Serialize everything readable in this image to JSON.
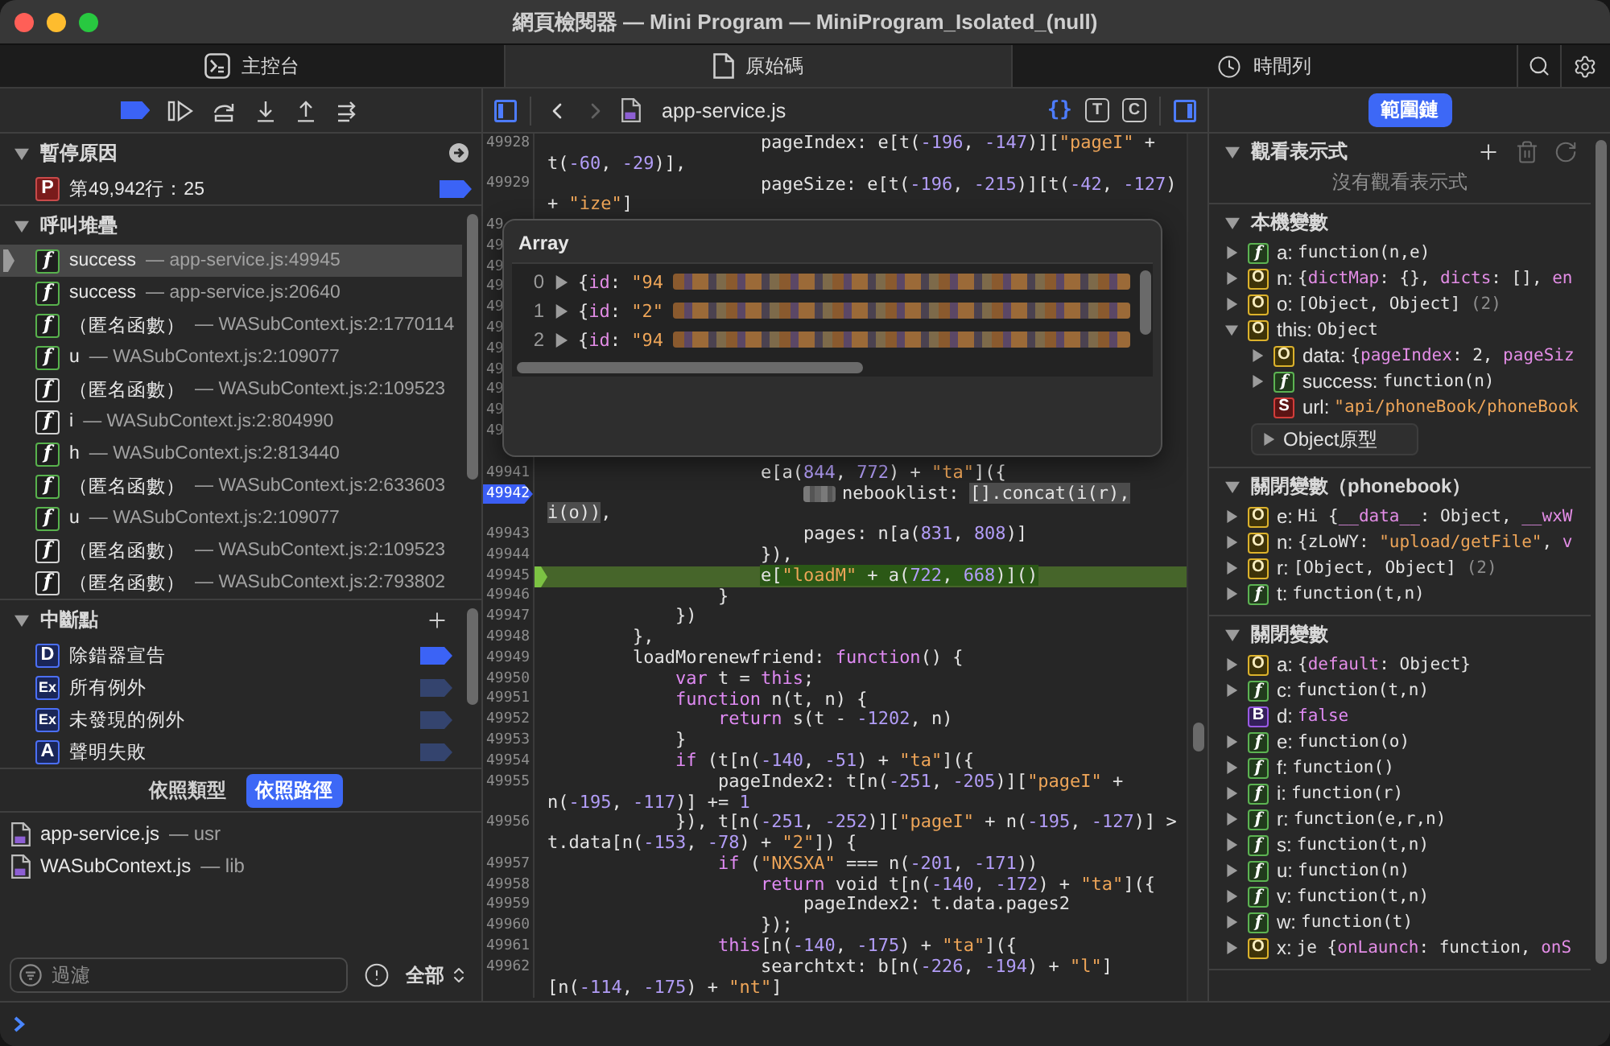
{
  "window": {
    "title": "網頁檢閱器 — Mini Program — MiniProgram_Isolated_(null)"
  },
  "tabs": [
    {
      "label": "主控台",
      "selected": false
    },
    {
      "label": "原始碼",
      "selected": true
    },
    {
      "label": "時間列",
      "selected": false
    }
  ],
  "debugger": {
    "breakpoints_active": true,
    "pause_reason": {
      "title": "暫停原因",
      "expanded": true,
      "badge": "P",
      "text": "第49,942行：25",
      "breakpoint_enabled": true
    },
    "call_stack": {
      "title": "呼叫堆疊",
      "expanded": true,
      "frames": [
        {
          "badge": "f",
          "color": "#58b24d",
          "name": "success",
          "location": "— app-service.js:49945",
          "selected": true
        },
        {
          "badge": "f",
          "color": "#58b24d",
          "name": "success",
          "location": "— app-service.js:20640",
          "selected": false
        },
        {
          "badge": "f",
          "color": "#58b24d",
          "name": "（匿名函數）",
          "location": "— WASubContext.js:2:1770114",
          "selected": false
        },
        {
          "badge": "f",
          "color": "#58b24d",
          "name": "u",
          "location": "— WASubContext.js:2:109077",
          "selected": false
        },
        {
          "badge": "f",
          "color": "#d2d2d2",
          "name": "（匿名函數）",
          "location": "— WASubContext.js:2:109523",
          "selected": false
        },
        {
          "badge": "f",
          "color": "#d2d2d2",
          "name": "i",
          "location": "— WASubContext.js:2:804990",
          "selected": false
        },
        {
          "badge": "f",
          "color": "#58b24d",
          "name": "h",
          "location": "— WASubContext.js:2:813440",
          "selected": false
        },
        {
          "badge": "f",
          "color": "#58b24d",
          "name": "（匿名函數）",
          "location": "— WASubContext.js:2:633603",
          "selected": false
        },
        {
          "badge": "f",
          "color": "#58b24d",
          "name": "u",
          "location": "— WASubContext.js:2:109077",
          "selected": false
        },
        {
          "badge": "f",
          "color": "#d2d2d2",
          "name": "（匿名函數）",
          "location": "— WASubContext.js:2:109523",
          "selected": false
        },
        {
          "badge": "f",
          "color": "#d2d2d2",
          "name": "（匿名函數）",
          "location": "— WASubContext.js:2:793802",
          "selected": false
        }
      ]
    },
    "breakpoints": {
      "title": "中斷點",
      "expanded": true,
      "items": [
        {
          "badge": "D",
          "label": "除錯器宣告",
          "enabled": true
        },
        {
          "badge": "Ex",
          "label": "所有例外",
          "enabled": false
        },
        {
          "badge": "Ex",
          "label": "未發現的例外",
          "enabled": false
        },
        {
          "badge": "A",
          "label": "聲明失敗",
          "enabled": false
        }
      ]
    },
    "grouping": [
      {
        "label": "依照類型",
        "selected": false
      },
      {
        "label": "依照路徑",
        "selected": true
      }
    ],
    "files": [
      {
        "name": "app-service.js",
        "origin": "— usr"
      },
      {
        "name": "WASubContext.js",
        "origin": "— lib"
      }
    ],
    "filter": {
      "placeholder": "過濾",
      "scope": "全部"
    }
  },
  "editor": {
    "file": "app-service.js",
    "back_enabled": true,
    "forward_enabled": false,
    "navigator_shown": true,
    "details_shown": true,
    "toggles": [
      {
        "kind": "brace",
        "label": "{}",
        "on": true
      },
      {
        "kind": "boxed",
        "label": "T",
        "on": false
      },
      {
        "kind": "boxed",
        "label": "C",
        "on": false
      }
    ],
    "lines": [
      {
        "number": "49928",
        "breakpoint": false,
        "current": false,
        "tokens": [
          {
            "kind": "plain",
            "text": "                    pageIndex: e[t("
          },
          {
            "kind": "number",
            "text": "-196"
          },
          {
            "kind": "plain",
            "text": ", "
          },
          {
            "kind": "number",
            "text": "-147"
          },
          {
            "kind": "plain",
            "text": ")]["
          },
          {
            "kind": "string",
            "text": "\"pageI\""
          },
          {
            "kind": "plain",
            "text": " +"
          }
        ],
        "wrap": [
          {
            "kind": "plain",
            "text": "t("
          },
          {
            "kind": "number",
            "text": "-60"
          },
          {
            "kind": "plain",
            "text": ", "
          },
          {
            "kind": "number",
            "text": "-29"
          },
          {
            "kind": "plain",
            "text": ")],"
          }
        ]
      },
      {
        "number": "49929",
        "breakpoint": false,
        "current": false,
        "tokens": [
          {
            "kind": "plain",
            "text": "                    pageSize: e[t("
          },
          {
            "kind": "number",
            "text": "-196"
          },
          {
            "kind": "plain",
            "text": ", "
          },
          {
            "kind": "number",
            "text": "-215"
          },
          {
            "kind": "plain",
            "text": ")][t("
          },
          {
            "kind": "number",
            "text": "-42"
          },
          {
            "kind": "plain",
            "text": ", "
          },
          {
            "kind": "number",
            "text": "-127"
          },
          {
            "kind": "plain",
            "text": ")"
          }
        ],
        "wrap": [
          {
            "kind": "plain",
            "text": "+ "
          },
          {
            "kind": "string",
            "text": "\"ize\""
          },
          {
            "kind": "plain",
            "text": "]"
          }
        ]
      },
      {
        "number": "49",
        "breakpoint": false
      },
      {
        "number": "49",
        "breakpoint": false
      },
      {
        "number": "49",
        "breakpoint": false
      },
      {
        "number": "49",
        "breakpoint": false
      },
      {
        "number": "49",
        "breakpoint": false
      },
      {
        "number": "49",
        "breakpoint": false
      },
      {
        "number": "49",
        "breakpoint": false
      },
      {
        "number": "49",
        "breakpoint": false
      },
      {
        "number": "49",
        "breakpoint": false
      },
      {
        "number": "49",
        "breakpoint": false
      },
      {
        "number": "49",
        "breakpoint": false
      },
      {
        "number": "49941",
        "breakpoint": false,
        "current": false,
        "tokens": [
          {
            "kind": "plain",
            "text": "                    e[a("
          },
          {
            "kind": "number",
            "text": "844"
          },
          {
            "kind": "plain",
            "text": ", "
          },
          {
            "kind": "number",
            "text": "772"
          },
          {
            "kind": "plain",
            "text": ") + "
          },
          {
            "kind": "string",
            "text": "\"ta\""
          },
          {
            "kind": "plain",
            "text": "]({"
          }
        ]
      },
      {
        "number": "49942",
        "breakpoint": true,
        "current": false,
        "tokens": [
          {
            "kind": "plain",
            "text": "                        nebooklist: ",
            "redacted_prefix": true
          },
          {
            "kind": "plain",
            "text": "[].concat(i(r),",
            "highlighted": true
          }
        ],
        "wrap": [
          {
            "kind": "plain",
            "text": "i(o))",
            "highlighted": true
          },
          {
            "kind": "plain",
            "text": ","
          }
        ]
      },
      {
        "number": "49943",
        "breakpoint": false,
        "current": false,
        "tokens": [
          {
            "kind": "plain",
            "text": "                        pages: n[a("
          },
          {
            "kind": "number",
            "text": "831"
          },
          {
            "kind": "plain",
            "text": ", "
          },
          {
            "kind": "number",
            "text": "808"
          },
          {
            "kind": "plain",
            "text": ")]"
          }
        ]
      },
      {
        "number": "49944",
        "breakpoint": false,
        "current": false,
        "tokens": [
          {
            "kind": "plain",
            "text": "                    }),"
          }
        ]
      },
      {
        "number": "49945",
        "breakpoint": false,
        "current": true,
        "tokens": [
          {
            "kind": "plain",
            "text": "                    e[",
            "highlighted": true
          },
          {
            "kind": "string",
            "text": "\"loadM\"",
            "highlighted": true
          },
          {
            "kind": "plain",
            "text": " + a(",
            "highlighted": true
          },
          {
            "kind": "number",
            "text": "722",
            "highlighted": true
          },
          {
            "kind": "plain",
            "text": ", ",
            "highlighted": true
          },
          {
            "kind": "number",
            "text": "668",
            "highlighted": true
          },
          {
            "kind": "plain",
            "text": ")]()",
            "highlighted": true
          }
        ]
      },
      {
        "number": "49946",
        "breakpoint": false,
        "current": false,
        "tokens": [
          {
            "kind": "plain",
            "text": "                }"
          }
        ]
      },
      {
        "number": "49947",
        "breakpoint": false,
        "current": false,
        "tokens": [
          {
            "kind": "plain",
            "text": "            })"
          }
        ]
      },
      {
        "number": "49948",
        "breakpoint": false,
        "current": false,
        "tokens": [
          {
            "kind": "plain",
            "text": "        },"
          }
        ]
      },
      {
        "number": "49949",
        "breakpoint": false,
        "current": false,
        "tokens": [
          {
            "kind": "plain",
            "text": "        loadMorenewfriend: "
          },
          {
            "kind": "keyword",
            "text": "function"
          },
          {
            "kind": "plain",
            "text": "() {"
          }
        ]
      },
      {
        "number": "49950",
        "breakpoint": false,
        "current": false,
        "tokens": [
          {
            "kind": "keyword",
            "text": "            var"
          },
          {
            "kind": "plain",
            "text": " t = "
          },
          {
            "kind": "keyword",
            "text": "this"
          },
          {
            "kind": "plain",
            "text": ";"
          }
        ]
      },
      {
        "number": "49951",
        "breakpoint": false,
        "current": false,
        "tokens": [
          {
            "kind": "keyword",
            "text": "            function"
          },
          {
            "kind": "plain",
            "text": " n(t, n) {"
          }
        ]
      },
      {
        "number": "49952",
        "breakpoint": false,
        "current": false,
        "tokens": [
          {
            "kind": "keyword",
            "text": "                return"
          },
          {
            "kind": "plain",
            "text": " s(t - "
          },
          {
            "kind": "number",
            "text": "-1202"
          },
          {
            "kind": "plain",
            "text": ", n)"
          }
        ]
      },
      {
        "number": "49953",
        "breakpoint": false,
        "current": false,
        "tokens": [
          {
            "kind": "plain",
            "text": "            }"
          }
        ]
      },
      {
        "number": "49954",
        "breakpoint": false,
        "current": false,
        "tokens": [
          {
            "kind": "keyword",
            "text": "            if"
          },
          {
            "kind": "plain",
            "text": " (t[n("
          },
          {
            "kind": "number",
            "text": "-140"
          },
          {
            "kind": "plain",
            "text": ", "
          },
          {
            "kind": "number",
            "text": "-51"
          },
          {
            "kind": "plain",
            "text": ") + "
          },
          {
            "kind": "string",
            "text": "\"ta\""
          },
          {
            "kind": "plain",
            "text": "]({"
          }
        ]
      },
      {
        "number": "49955",
        "breakpoint": false,
        "current": false,
        "tokens": [
          {
            "kind": "plain",
            "text": "                pageIndex2: t[n("
          },
          {
            "kind": "number",
            "text": "-251"
          },
          {
            "kind": "plain",
            "text": ", "
          },
          {
            "kind": "number",
            "text": "-205"
          },
          {
            "kind": "plain",
            "text": ")]["
          },
          {
            "kind": "string",
            "text": "\"pageI\""
          },
          {
            "kind": "plain",
            "text": " +"
          }
        ],
        "wrap": [
          {
            "kind": "plain",
            "text": "n("
          },
          {
            "kind": "number",
            "text": "-195"
          },
          {
            "kind": "plain",
            "text": ", "
          },
          {
            "kind": "number",
            "text": "-117"
          },
          {
            "kind": "plain",
            "text": ")] += "
          },
          {
            "kind": "number",
            "text": "1"
          }
        ]
      },
      {
        "number": "49956",
        "breakpoint": false,
        "current": false,
        "tokens": [
          {
            "kind": "plain",
            "text": "            }), t[n("
          },
          {
            "kind": "number",
            "text": "-251"
          },
          {
            "kind": "plain",
            "text": ", "
          },
          {
            "kind": "number",
            "text": "-252"
          },
          {
            "kind": "plain",
            "text": ")]["
          },
          {
            "kind": "string",
            "text": "\"pageI\""
          },
          {
            "kind": "plain",
            "text": " + n("
          },
          {
            "kind": "number",
            "text": "-195"
          },
          {
            "kind": "plain",
            "text": ", "
          },
          {
            "kind": "number",
            "text": "-127"
          },
          {
            "kind": "plain",
            "text": ")] >"
          }
        ],
        "wrap": [
          {
            "kind": "plain",
            "text": "t.data[n("
          },
          {
            "kind": "number",
            "text": "-153"
          },
          {
            "kind": "plain",
            "text": ", "
          },
          {
            "kind": "number",
            "text": "-78"
          },
          {
            "kind": "plain",
            "text": ") + "
          },
          {
            "kind": "string",
            "text": "\"2\""
          },
          {
            "kind": "plain",
            "text": "]) {"
          }
        ]
      },
      {
        "number": "49957",
        "breakpoint": false,
        "current": false,
        "tokens": [
          {
            "kind": "keyword",
            "text": "                if"
          },
          {
            "kind": "plain",
            "text": " ("
          },
          {
            "kind": "string",
            "text": "\"NXSXA\""
          },
          {
            "kind": "plain",
            "text": " === n("
          },
          {
            "kind": "number",
            "text": "-201"
          },
          {
            "kind": "plain",
            "text": ", "
          },
          {
            "kind": "number",
            "text": "-171"
          },
          {
            "kind": "plain",
            "text": "))"
          }
        ]
      },
      {
        "number": "49958",
        "breakpoint": false,
        "current": false,
        "tokens": [
          {
            "kind": "keyword",
            "text": "                    return"
          },
          {
            "kind": "plain",
            "text": " void t[n("
          },
          {
            "kind": "number",
            "text": "-140"
          },
          {
            "kind": "plain",
            "text": ", "
          },
          {
            "kind": "number",
            "text": "-172"
          },
          {
            "kind": "plain",
            "text": ") + "
          },
          {
            "kind": "string",
            "text": "\"ta\""
          },
          {
            "kind": "plain",
            "text": "]({"
          }
        ]
      },
      {
        "number": "49959",
        "breakpoint": false,
        "current": false,
        "tokens": [
          {
            "kind": "plain",
            "text": "                        pageIndex2: t.data.pages2"
          }
        ]
      },
      {
        "number": "49960",
        "breakpoint": false,
        "current": false,
        "tokens": [
          {
            "kind": "plain",
            "text": "                    });"
          }
        ]
      },
      {
        "number": "49961",
        "breakpoint": false,
        "current": false,
        "tokens": [
          {
            "kind": "keyword",
            "text": "                this"
          },
          {
            "kind": "plain",
            "text": "[n("
          },
          {
            "kind": "number",
            "text": "-140"
          },
          {
            "kind": "plain",
            "text": ", "
          },
          {
            "kind": "number",
            "text": "-175"
          },
          {
            "kind": "plain",
            "text": ") + "
          },
          {
            "kind": "string",
            "text": "\"ta\""
          },
          {
            "kind": "plain",
            "text": "]({"
          }
        ]
      },
      {
        "number": "49962",
        "breakpoint": false,
        "current": false,
        "tokens": [
          {
            "kind": "plain",
            "text": "                    searchtxt: b[n("
          },
          {
            "kind": "number",
            "text": "-226"
          },
          {
            "kind": "plain",
            "text": ", "
          },
          {
            "kind": "number",
            "text": "-194"
          },
          {
            "kind": "plain",
            "text": ") + "
          },
          {
            "kind": "string",
            "text": "\"l\""
          },
          {
            "kind": "plain",
            "text": "]"
          }
        ],
        "wrap": [
          {
            "kind": "plain",
            "text": "[n("
          },
          {
            "kind": "number",
            "text": "-114"
          },
          {
            "kind": "plain",
            "text": ", "
          },
          {
            "kind": "number",
            "text": "-175"
          },
          {
            "kind": "plain",
            "text": ") + "
          },
          {
            "kind": "string",
            "text": "\"nt\""
          },
          {
            "kind": "plain",
            "text": "]"
          }
        ]
      }
    ],
    "popover": {
      "title": "Array",
      "items": [
        {
          "index": "0",
          "expanded": false,
          "preview": [
            {
              "kind": "plain",
              "text": "{"
            },
            {
              "kind": "key",
              "text": "id"
            },
            {
              "kind": "plain",
              "text": ": "
            },
            {
              "kind": "string",
              "text": "\"94"
            }
          ]
        },
        {
          "index": "1",
          "expanded": false,
          "preview": [
            {
              "kind": "plain",
              "text": "{"
            },
            {
              "kind": "key",
              "text": "id"
            },
            {
              "kind": "plain",
              "text": ": "
            },
            {
              "kind": "string",
              "text": "\"2\""
            }
          ]
        },
        {
          "index": "2",
          "expanded": false,
          "preview": [
            {
              "kind": "plain",
              "text": "{"
            },
            {
              "kind": "key",
              "text": "id"
            },
            {
              "kind": "plain",
              "text": ": "
            },
            {
              "kind": "string",
              "text": "\"94"
            }
          ]
        }
      ]
    }
  },
  "details": {
    "tabs": [
      {
        "label": "範圍鏈",
        "selected": true
      }
    ],
    "sections": [
      {
        "kind": "watch",
        "title": "觀看表示式",
        "expanded": true,
        "actions": [
          {
            "disabled": false
          },
          {
            "disabled": true
          },
          {
            "disabled": true
          }
        ],
        "empty_message": "沒有觀看表示式"
      },
      {
        "kind": "variables",
        "title": "本機變數",
        "expanded": true,
        "variables": [
          {
            "kind": "function",
            "badge": "f",
            "name": "a:",
            "expanded": false,
            "value": [
              {
                "kind": "plain",
                "text": "function(n,e)"
              }
            ]
          },
          {
            "kind": "object",
            "badge": "O",
            "name": "n:",
            "expanded": false,
            "value": [
              {
                "kind": "plain",
                "text": "{"
              },
              {
                "kind": "key",
                "text": "dictMap"
              },
              {
                "kind": "plain",
                "text": ": {}, "
              },
              {
                "kind": "key",
                "text": "dicts"
              },
              {
                "kind": "plain",
                "text": ": [], "
              },
              {
                "kind": "key",
                "text": "en"
              }
            ]
          },
          {
            "kind": "object",
            "badge": "O",
            "name": "o:",
            "expanded": false,
            "value": [
              {
                "kind": "plain",
                "text": "[Object, Object] "
              },
              {
                "kind": "muted",
                "text": "(2)"
              }
            ]
          },
          {
            "kind": "object",
            "badge": "O",
            "name": "this:",
            "expanded": true,
            "value": [
              {
                "kind": "plain",
                "text": "Object"
              }
            ],
            "children": [
              {
                "kind": "object",
                "badge": "O",
                "name": "data:",
                "expanded": false,
                "value": [
                  {
                    "kind": "plain",
                    "text": "{"
                  },
                  {
                    "kind": "key",
                    "text": "pageIndex"
                  },
                  {
                    "kind": "plain",
                    "text": ": 2, "
                  },
                  {
                    "kind": "key",
                    "text": "pageSiz"
                  }
                ]
              },
              {
                "kind": "function",
                "badge": "f",
                "name": "success:",
                "expanded": false,
                "value": [
                  {
                    "kind": "plain",
                    "text": "function(n)"
                  }
                ]
              },
              {
                "kind": "string",
                "badge": "S",
                "name": "url:",
                "value": [
                  {
                    "kind": "string",
                    "text": "\"api/phoneBook/phoneBook"
                  }
                ]
              }
            ],
            "prototype": {
              "label": "Object原型",
              "expanded": false
            }
          }
        ]
      },
      {
        "kind": "variables",
        "title": "關閉變數（phonebook）",
        "expanded": true,
        "variables": [
          {
            "kind": "object",
            "badge": "O",
            "name": "e:",
            "expanded": false,
            "value": [
              {
                "kind": "plain",
                "text": "Hi {"
              },
              {
                "kind": "key",
                "text": "__data__"
              },
              {
                "kind": "plain",
                "text": ": Object, "
              },
              {
                "kind": "key",
                "text": "__wxW"
              }
            ]
          },
          {
            "kind": "object",
            "badge": "O",
            "name": "n:",
            "expanded": false,
            "value": [
              {
                "kind": "plain",
                "text": "{zLoWY: "
              },
              {
                "kind": "string",
                "text": "\"upload/getFile\""
              },
              {
                "kind": "plain",
                "text": ", "
              },
              {
                "kind": "key",
                "text": "v"
              }
            ]
          },
          {
            "kind": "object",
            "badge": "O",
            "name": "r:",
            "expanded": false,
            "value": [
              {
                "kind": "plain",
                "text": "[Object, Object] "
              },
              {
                "kind": "muted",
                "text": "(2)"
              }
            ]
          },
          {
            "kind": "function",
            "badge": "f",
            "name": "t:",
            "expanded": false,
            "value": [
              {
                "kind": "plain",
                "text": "function(t,n)"
              }
            ]
          }
        ]
      },
      {
        "kind": "variables",
        "title": "關閉變數",
        "expanded": true,
        "variables": [
          {
            "kind": "object",
            "badge": "O",
            "name": "a:",
            "expanded": false,
            "value": [
              {
                "kind": "plain",
                "text": "{"
              },
              {
                "kind": "key",
                "text": "default"
              },
              {
                "kind": "plain",
                "text": ": Object}"
              }
            ]
          },
          {
            "kind": "function",
            "badge": "f",
            "name": "c:",
            "expanded": false,
            "value": [
              {
                "kind": "plain",
                "text": "function(t,n)"
              }
            ]
          },
          {
            "kind": "boolean",
            "badge": "B",
            "name": "d:",
            "value": [
              {
                "kind": "keyword",
                "text": "false"
              }
            ]
          },
          {
            "kind": "function",
            "badge": "f",
            "name": "e:",
            "expanded": false,
            "value": [
              {
                "kind": "plain",
                "text": "function(o)"
              }
            ]
          },
          {
            "kind": "function",
            "badge": "f",
            "name": "f:",
            "expanded": false,
            "value": [
              {
                "kind": "plain",
                "text": "function()"
              }
            ]
          },
          {
            "kind": "function",
            "badge": "f",
            "name": "i:",
            "expanded": false,
            "value": [
              {
                "kind": "plain",
                "text": "function(r)"
              }
            ]
          },
          {
            "kind": "function",
            "badge": "f",
            "name": "r:",
            "expanded": false,
            "value": [
              {
                "kind": "plain",
                "text": "function(e,r,n)"
              }
            ]
          },
          {
            "kind": "function",
            "badge": "f",
            "name": "s:",
            "expanded": false,
            "value": [
              {
                "kind": "plain",
                "text": "function(t,n)"
              }
            ]
          },
          {
            "kind": "function",
            "badge": "f",
            "name": "u:",
            "expanded": false,
            "value": [
              {
                "kind": "plain",
                "text": "function(n)"
              }
            ]
          },
          {
            "kind": "function",
            "badge": "f",
            "name": "v:",
            "expanded": false,
            "value": [
              {
                "kind": "plain",
                "text": "function(t,n)"
              }
            ]
          },
          {
            "kind": "function",
            "badge": "f",
            "name": "w:",
            "expanded": false,
            "value": [
              {
                "kind": "plain",
                "text": "function(t)"
              }
            ]
          },
          {
            "kind": "object",
            "badge": "O",
            "name": "x:",
            "expanded": false,
            "value": [
              {
                "kind": "plain",
                "text": "je {"
              },
              {
                "kind": "key",
                "text": "onLaunch"
              },
              {
                "kind": "plain",
                "text": ": function, "
              },
              {
                "kind": "key",
                "text": "onS"
              }
            ]
          }
        ]
      }
    ]
  }
}
